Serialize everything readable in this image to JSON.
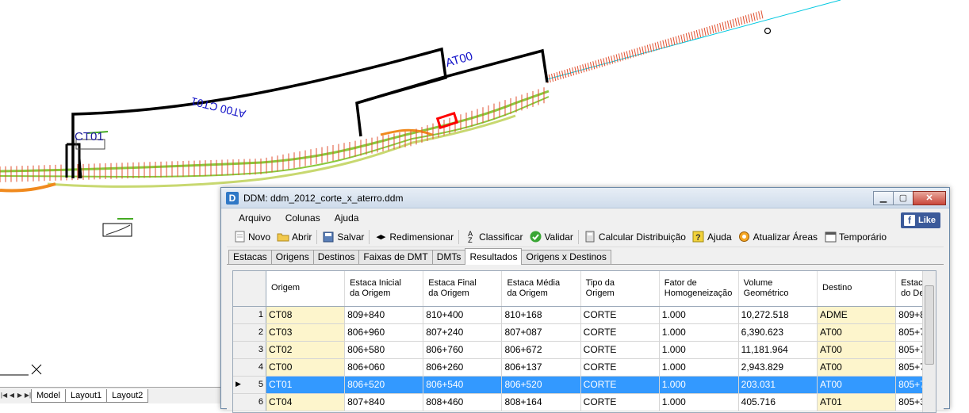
{
  "cad": {
    "labels": {
      "ct01": "CT01",
      "at00": "AT00",
      "at00_ct01": "AT00 CT01"
    },
    "line_colors": {
      "alignment": "#00c8e0",
      "ticks": "#e05030",
      "road": "#8ac83c",
      "fill": "#f08a1e",
      "region": "#000000",
      "marker": "#ff0000"
    }
  },
  "layout_tabs": {
    "model": "Model",
    "layout1": "Layout1",
    "layout2": "Layout2"
  },
  "window": {
    "title": "DDM: ddm_2012_corte_x_aterro.ddm",
    "app_icon": "D",
    "menu": [
      "Arquivo",
      "Colunas",
      "Ajuda"
    ],
    "fb_like": "Like",
    "toolbar": {
      "novo": "Novo",
      "abrir": "Abrir",
      "salvar": "Salvar",
      "redimensionar": "Redimensionar",
      "classificar": "Classificar",
      "validar": "Validar",
      "calcular": "Calcular Distribuição",
      "ajuda": "Ajuda",
      "atualizar": "Atualizar Áreas",
      "temporario": "Temporário"
    },
    "tabs": [
      "Estacas",
      "Origens",
      "Destinos",
      "Faixas de DMT",
      "DMTs",
      "Resultados",
      "Origens x Destinos"
    ],
    "active_tab": "Resultados"
  },
  "grid": {
    "headers": {
      "origem": "Origem",
      "est_ini_1": "Estaca Inicial",
      "est_ini_2": "da Origem",
      "est_fin_1": "Estaca Final",
      "est_fin_2": "da Origem",
      "est_med_1": "Estaca Média",
      "est_med_2": "da Origem",
      "tipo_1": "Tipo da",
      "tipo_2": "Origem",
      "fator_1": "Fator de",
      "fator_2": "Homogeneização",
      "vol_1": "Volume",
      "vol_2": "Geométrico",
      "destino": "Destino",
      "est_dest_1": "Estac",
      "est_dest_2": "do De"
    },
    "rows": [
      {
        "n": "1",
        "origem": "CT08",
        "ini": "809+840",
        "fin": "810+400",
        "med": "810+168",
        "tipo": "CORTE",
        "fator": "1.000",
        "vol": "10,272.518",
        "destino": "ADME",
        "est": "809+8"
      },
      {
        "n": "2",
        "origem": "CT03",
        "ini": "806+960",
        "fin": "807+240",
        "med": "807+087",
        "tipo": "CORTE",
        "fator": "1.000",
        "vol": "6,390.623",
        "destino": "AT00",
        "est": "805+7"
      },
      {
        "n": "3",
        "origem": "CT02",
        "ini": "806+580",
        "fin": "806+760",
        "med": "806+672",
        "tipo": "CORTE",
        "fator": "1.000",
        "vol": "11,181.964",
        "destino": "AT00",
        "est": "805+7"
      },
      {
        "n": "4",
        "origem": "CT00",
        "ini": "806+060",
        "fin": "806+260",
        "med": "806+137",
        "tipo": "CORTE",
        "fator": "1.000",
        "vol": "2,943.829",
        "destino": "AT00",
        "est": "805+7"
      },
      {
        "n": "5",
        "origem": "CT01",
        "ini": "806+520",
        "fin": "806+540",
        "med": "806+520",
        "tipo": "CORTE",
        "fator": "1.000",
        "vol": "203.031",
        "destino": "AT00",
        "est": "805+7"
      },
      {
        "n": "6",
        "origem": "CT04",
        "ini": "807+840",
        "fin": "808+460",
        "med": "808+164",
        "tipo": "CORTE",
        "fator": "1.000",
        "vol": "405.716",
        "destino": "AT01",
        "est": "805+3"
      }
    ],
    "selected_row": "5"
  }
}
